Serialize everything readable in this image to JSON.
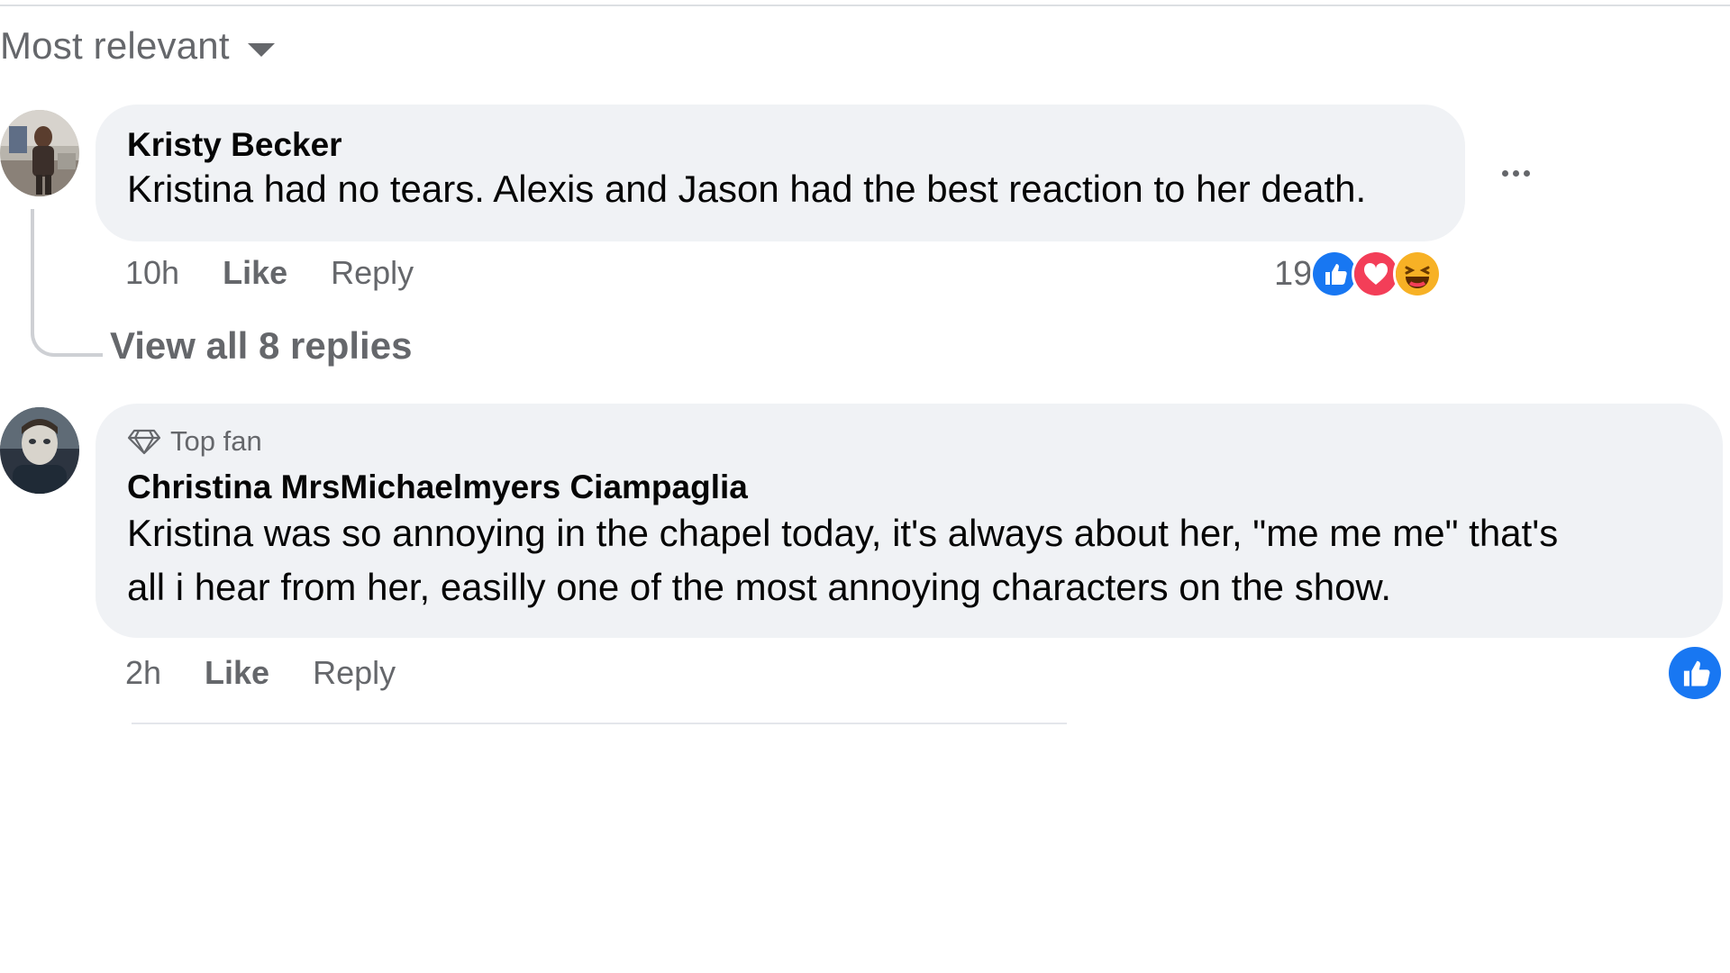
{
  "sort": {
    "label": "Most relevant",
    "icon": "caret-down-icon"
  },
  "comments": [
    {
      "author": "Kristy Becker",
      "text": "Kristina had no tears. Alexis and Jason had the best reaction to her death.",
      "time": "10h",
      "like_label": "Like",
      "reply_label": "Reply",
      "reaction_count": "19",
      "reactions": [
        "like-icon",
        "love-icon",
        "haha-icon"
      ],
      "more_icon": "more-options-icon",
      "view_replies_label": "View all 8 replies"
    },
    {
      "badge": "Top fan",
      "badge_icon": "diamond-icon",
      "author": "Christina MrsMichaelmyers Ciampaglia",
      "text_line1": "Kristina was so annoying in the chapel today, it's always about her, \"me me me\" that's",
      "text_line2": "all i hear from her, easilly one of the most annoying characters on the show.",
      "time": "2h",
      "like_label": "Like",
      "reply_label": "Reply",
      "reactions": [
        "like-icon"
      ]
    }
  ],
  "colors": {
    "bubble": "#f0f2f5",
    "secondary_text": "#65676b",
    "like_blue": "#1877f2",
    "love_red": "#f33e58",
    "haha_yellow": "#f7b125"
  }
}
